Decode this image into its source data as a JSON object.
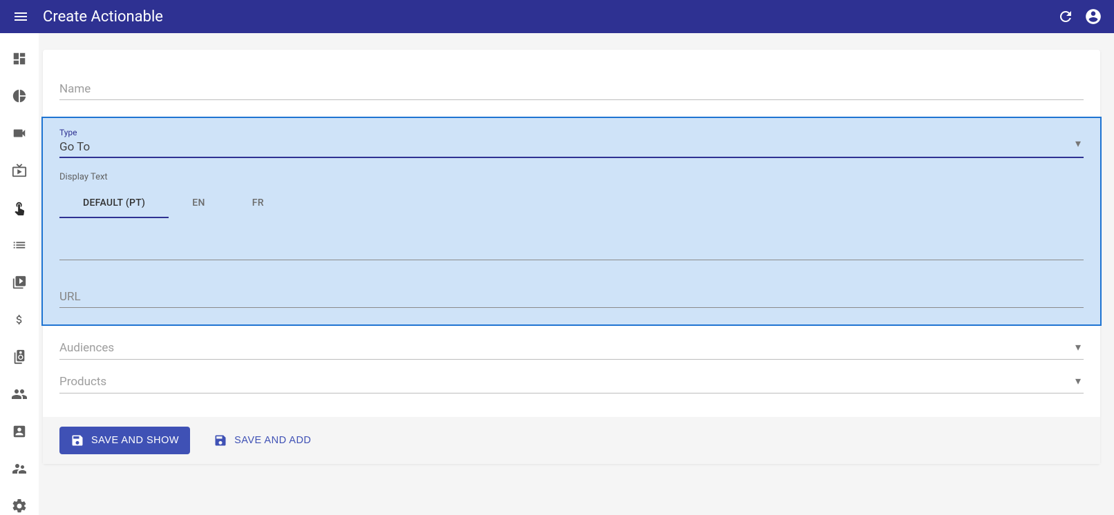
{
  "header": {
    "title": "Create Actionable"
  },
  "sidebar": {
    "items": [
      {
        "name": "dashboard-icon"
      },
      {
        "name": "chart-icon"
      },
      {
        "name": "video-icon"
      },
      {
        "name": "live-tv-icon"
      },
      {
        "name": "touch-icon"
      },
      {
        "name": "list-icon"
      },
      {
        "name": "video-library-icon"
      },
      {
        "name": "monetization-icon"
      },
      {
        "name": "speaker-group-icon"
      },
      {
        "name": "group-icon"
      },
      {
        "name": "account-box-icon"
      },
      {
        "name": "supervisor-icon"
      },
      {
        "name": "settings-icon"
      }
    ]
  },
  "form": {
    "name": {
      "label": "Name",
      "value": ""
    },
    "type": {
      "label": "Type",
      "value": "Go To"
    },
    "displayText": {
      "label": "Display Text",
      "tabs": [
        {
          "label": "DEFAULT (PT)",
          "active": true
        },
        {
          "label": "EN",
          "active": false
        },
        {
          "label": "FR",
          "active": false
        }
      ],
      "value": ""
    },
    "url": {
      "label": "URL",
      "value": ""
    },
    "audiences": {
      "placeholder": "Audiences"
    },
    "products": {
      "placeholder": "Products"
    }
  },
  "actions": {
    "saveAndShow": "SAVE AND SHOW",
    "saveAndAdd": "SAVE AND ADD"
  }
}
